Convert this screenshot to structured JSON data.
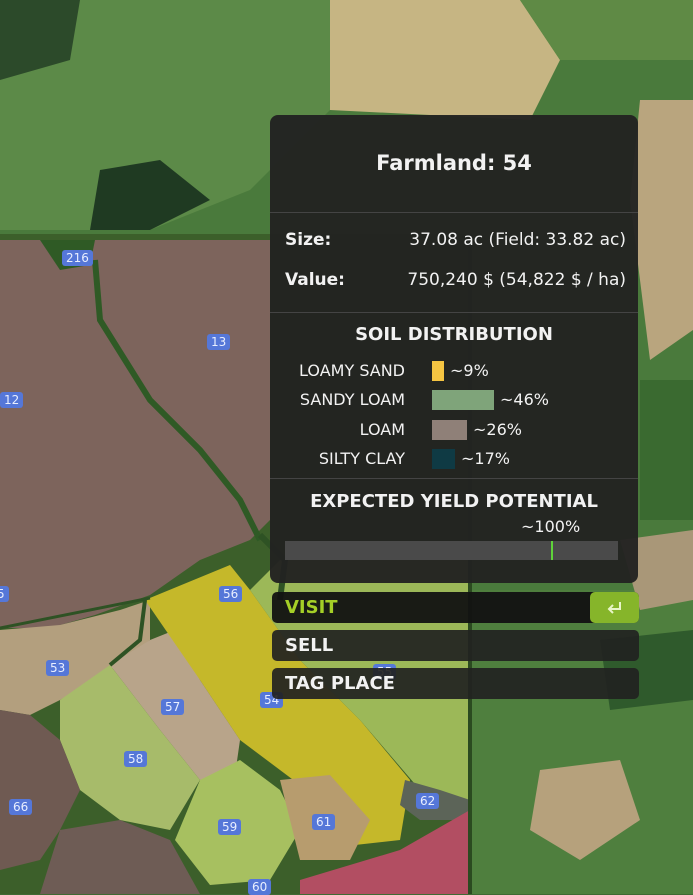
{
  "panel": {
    "title": "Farmland: 54",
    "size_label": "Size:",
    "size_value": "37.08 ac (Field: 33.82 ac)",
    "value_label": "Value:",
    "value_value": "750,240 $ (54,822 $ / ha)",
    "soil_title": "SOIL DISTRIBUTION",
    "soil": [
      {
        "name": "LOAMY SAND",
        "percent_label": "~9%",
        "percent": 9,
        "color": "#f5c542"
      },
      {
        "name": "SANDY LOAM",
        "percent_label": "~46%",
        "percent": 46,
        "color": "#7fa47a"
      },
      {
        "name": "LOAM",
        "percent_label": "~26%",
        "percent": 26,
        "color": "#8f8078"
      },
      {
        "name": "SILTY CLAY",
        "percent_label": "~17%",
        "percent": 17,
        "color": "#0f3a44"
      }
    ],
    "yield_title": "EXPECTED YIELD POTENTIAL",
    "yield_label": "~100%",
    "yield_fraction": 0.8
  },
  "actions": {
    "visit": "VISIT",
    "sell": "SELL",
    "tag_place": "TAG PLACE"
  },
  "icons": {
    "enter": "enter-key-icon"
  },
  "colors": {
    "accent": "#a5cf27",
    "enter_button": "#86b52a",
    "yield_marker": "#5fd33a",
    "panel_bg": "#222221"
  },
  "map": {
    "field_labels": [
      "216",
      "13",
      "12",
      "5",
      "56",
      "53",
      "57",
      "54",
      "58",
      "66",
      "59",
      "61",
      "62",
      "60",
      "55"
    ]
  }
}
